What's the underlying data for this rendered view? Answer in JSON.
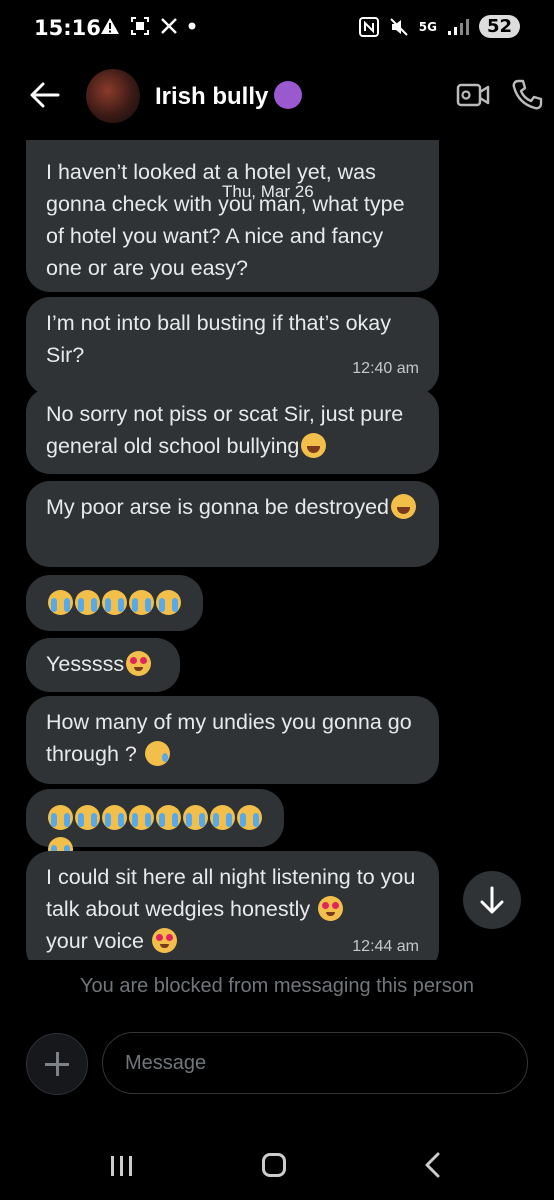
{
  "status_bar": {
    "time": "15:16",
    "left_icons": [
      "warning-icon",
      "screenshot-icon",
      "x-logo-icon",
      "dot-icon"
    ],
    "network": "5G",
    "battery": "52"
  },
  "header": {
    "title": "Irish bully",
    "title_emoji": "smiling-face-with-horns-icon"
  },
  "chat": {
    "date_overlay": "Thu, Mar 26",
    "messages": [
      {
        "text": "I haven’t looked at a hotel yet, was gonna check with you man, what type of hotel you want? A nice and fancy one or are you easy?",
        "time": ""
      },
      {
        "text": "I’m not into ball busting if that’s okay Sir?",
        "time": "12:40 am"
      },
      {
        "text": "No sorry not piss or scat Sir, just pure general old school bullying",
        "time": ""
      },
      {
        "text": "My poor arse is gonna be destroyed",
        "time": ""
      },
      {
        "text": "",
        "time": ""
      },
      {
        "text": "Yesssss",
        "time": ""
      },
      {
        "text": "How many of my undies you gonna go through ?",
        "time": ""
      },
      {
        "text": "",
        "time": ""
      },
      {
        "text": "I could sit here all night listening to you talk about wedgies honestly",
        "text_tail": "your voice",
        "time": "12:44 am"
      }
    ]
  },
  "blocked_notice": "You are blocked from messaging this person",
  "composer": {
    "placeholder": "Message"
  },
  "colors": {
    "background": "#000000",
    "bubble": "#2f3336",
    "muted_text": "#71767b"
  }
}
